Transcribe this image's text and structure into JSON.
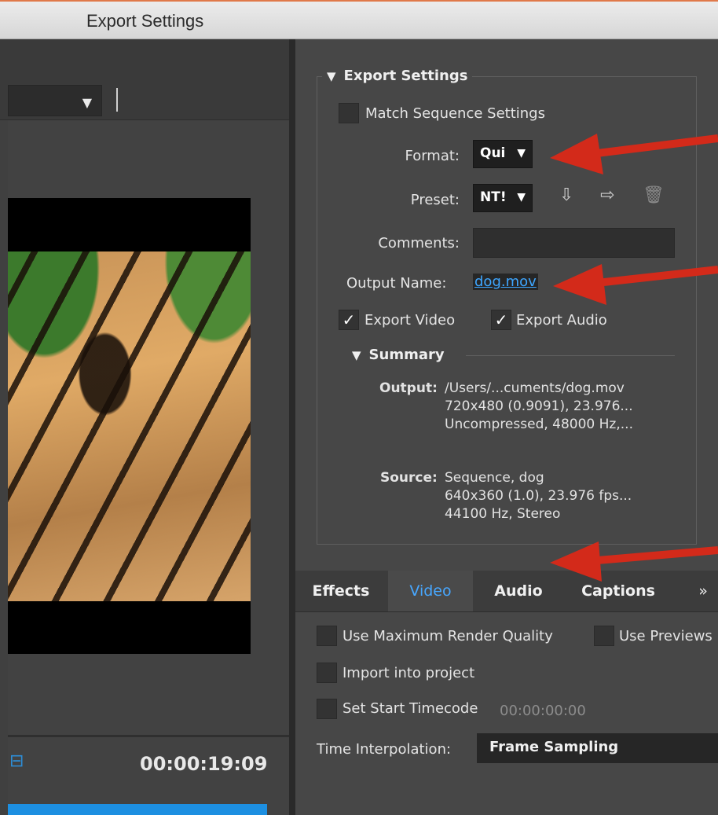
{
  "window": {
    "title": "Export Settings"
  },
  "preview": {
    "timecode": "00:00:19:09"
  },
  "export_settings": {
    "heading": "Export Settings",
    "match_sequence_label": "Match Sequence Settings",
    "format_label": "Format:",
    "format_value": "Qui",
    "preset_label": "Preset:",
    "preset_value": "NT!",
    "comments_label": "Comments:",
    "comments_value": "",
    "output_name_label": "Output Name:",
    "output_name_value": "dog.mov",
    "export_video_label": "Export Video",
    "export_video_checked": true,
    "export_audio_label": "Export Audio",
    "export_audio_checked": true
  },
  "summary": {
    "heading": "Summary",
    "output_key": "Output:",
    "output_lines": [
      "/Users/...cuments/dog.mov",
      "720x480 (0.9091), 23.976...",
      "Uncompressed, 48000 Hz,..."
    ],
    "source_key": "Source:",
    "source_lines": [
      "Sequence, dog",
      "640x360 (1.0), 23.976 fps...",
      "44100 Hz, Stereo"
    ]
  },
  "tabs": [
    {
      "label": "Effects",
      "active": false
    },
    {
      "label": "Video",
      "active": true
    },
    {
      "label": "Audio",
      "active": false
    },
    {
      "label": "Captions",
      "active": false
    },
    {
      "label": "»",
      "active": false
    }
  ],
  "options": {
    "max_render_quality_label": "Use Maximum Render Quality",
    "use_previews_label": "Use Previews",
    "import_into_project_label": "Import into project",
    "set_start_timecode_label": "Set Start Timecode",
    "start_timecode_value": "00:00:00:00",
    "time_interpolation_label": "Time Interpolation:",
    "time_interpolation_value": "Frame Sampling"
  },
  "colors": {
    "accent": "#3ea6ff",
    "annotation_red": "#d32a1a",
    "progress": "#1d8fe1"
  },
  "icons": [
    "chevron-down-icon",
    "save-preset-icon",
    "import-preset-icon",
    "trash-icon",
    "render-bar-icon",
    "checkmark-icon",
    "disclosure-triangle-icon"
  ]
}
